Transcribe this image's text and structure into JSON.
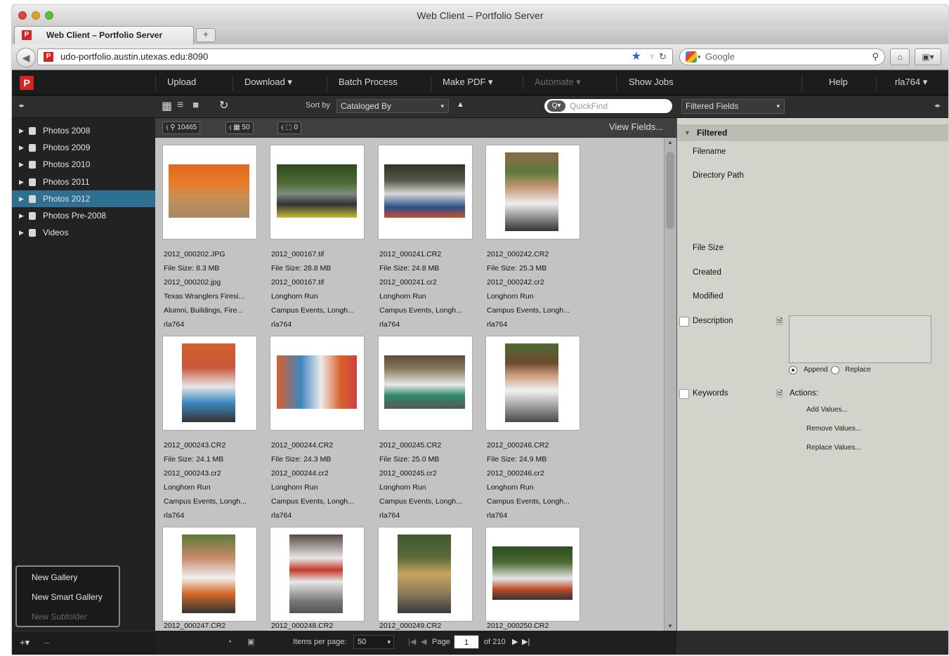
{
  "window": {
    "title": "Web Client – Portfolio Server"
  },
  "browser": {
    "tab_title": "Web Client – Portfolio Server",
    "new_tab_label": "+",
    "url": "udo-portfolio.austin.utexas.edu:8090",
    "search_placeholder": "Google"
  },
  "app": {
    "logo": "P",
    "menus": [
      {
        "label": "Upload",
        "enabled": true
      },
      {
        "label": "Download ▾",
        "enabled": true
      },
      {
        "label": "Batch Process",
        "enabled": true
      },
      {
        "label": "Make PDF ▾",
        "enabled": true
      },
      {
        "label": "Automate ▾",
        "enabled": false
      },
      {
        "label": "Show Jobs",
        "enabled": true
      },
      {
        "label": "Help",
        "enabled": true
      },
      {
        "label": "rla764 ▾",
        "enabled": true
      }
    ]
  },
  "toolbar": {
    "sort_by_label": "Sort by",
    "sort_value": "Cataloged By",
    "quickfind_placeholder": "QuickFind",
    "filtered_fields_label": "Filtered Fields"
  },
  "counts": {
    "total": "10465",
    "per_page": "50",
    "selected": "0"
  },
  "view_fields_label": "View Fields...",
  "sidebar": {
    "items": [
      {
        "label": "Photos 2008",
        "selected": false
      },
      {
        "label": "Photos 2009",
        "selected": false
      },
      {
        "label": "Photos 2010",
        "selected": false
      },
      {
        "label": "Photos 2011",
        "selected": false
      },
      {
        "label": "Photos 2012",
        "selected": true
      },
      {
        "label": "Photos Pre-2008",
        "selected": false
      },
      {
        "label": "Videos",
        "selected": false
      }
    ],
    "gallery_menu": [
      "New Gallery",
      "New Smart Gallery",
      "New Subfolder"
    ],
    "footer_add": "+▾",
    "footer_remove": "–"
  },
  "assets": [
    {
      "name": "2012_000202.JPG",
      "size": "File Size: 8.3 MB",
      "file": "2012_000202.jpg",
      "title": "Texas Wranglers Firesi...",
      "keywords": "Alumni, Buildings, Fire...",
      "user": "rla764"
    },
    {
      "name": "2012_000167.tif",
      "size": "File Size: 28.8 MB",
      "file": "2012_000167.tif",
      "title": "Longhorn Run",
      "keywords": "Campus Events, Longh...",
      "user": "rla764"
    },
    {
      "name": "2012_000241.CR2",
      "size": "File Size: 24.8 MB",
      "file": "2012_000241.cr2",
      "title": "Longhorn Run",
      "keywords": "Campus Events, Longh...",
      "user": "rla764"
    },
    {
      "name": "2012_000242.CR2",
      "size": "File Size: 25.3 MB",
      "file": "2012_000242.cr2",
      "title": "Longhorn Run",
      "keywords": "Campus Events, Longh...",
      "user": "rla764"
    },
    {
      "name": "2012_000243.CR2",
      "size": "File Size: 24.1 MB",
      "file": "2012_000243.cr2",
      "title": "Longhorn Run",
      "keywords": "Campus Events, Longh...",
      "user": "rla764"
    },
    {
      "name": "2012_000244.CR2",
      "size": "File Size: 24.3 MB",
      "file": "2012_000244.cr2",
      "title": "Longhorn Run",
      "keywords": "Campus Events, Longh...",
      "user": "rla764"
    },
    {
      "name": "2012_000245.CR2",
      "size": "File Size: 25.0 MB",
      "file": "2012_000245.cr2",
      "title": "Longhorn Run",
      "keywords": "Campus Events, Longh...",
      "user": "rla764"
    },
    {
      "name": "2012_000246.CR2",
      "size": "File Size: 24.9 MB",
      "file": "2012_000246.cr2",
      "title": "Longhorn Run",
      "keywords": "Campus Events, Longh...",
      "user": "rla764"
    },
    {
      "name": "2012_000247.CR2"
    },
    {
      "name": "2012_000248.CR2"
    },
    {
      "name": "2012_000249.CR2"
    },
    {
      "name": "2012_000250.CR2"
    }
  ],
  "pagination": {
    "items_per_page_label": "Items per page:",
    "items_per_page": "50",
    "page_label": "Page",
    "page": "1",
    "of_label": "of 210"
  },
  "filter_panel": {
    "section": "Filtered",
    "fields": [
      "Filename",
      "Directory Path",
      "File Size",
      "Created",
      "Modified"
    ],
    "description_label": "Description",
    "keywords_label": "Keywords",
    "append_label": "Append",
    "replace_label": "Replace",
    "actions_label": "Actions:",
    "actions": [
      "Add Values...",
      "Remove Values...",
      "Replace Values..."
    ]
  },
  "colors": {
    "accent": "#2f6f92",
    "logo": "#d32424",
    "panel": "#d3d3cb"
  }
}
